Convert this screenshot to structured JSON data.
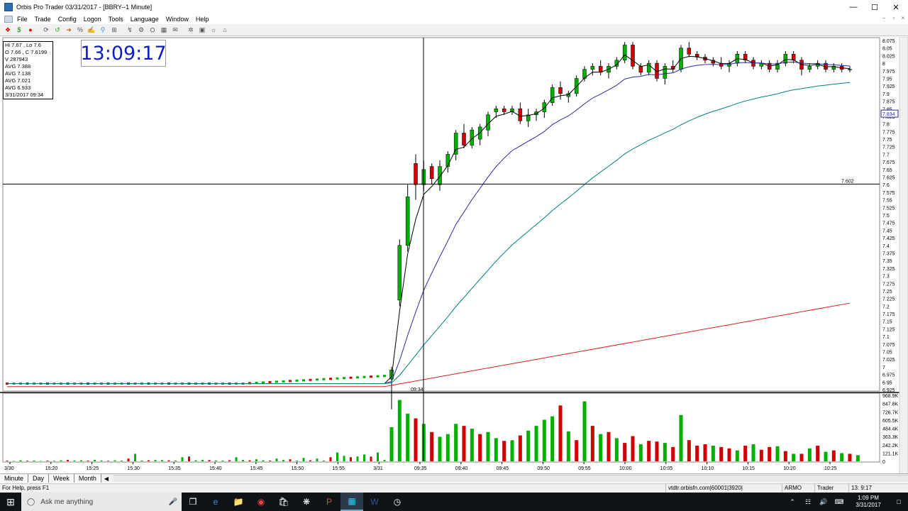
{
  "window": {
    "title": "Orbis Pro Trader 03/31/2017 - [BBRY--1 Minute]",
    "minimize": "—",
    "maximize": "☐",
    "close": "✕"
  },
  "menu": [
    "File",
    "Trade",
    "Config",
    "Logon",
    "Tools",
    "Language",
    "Window",
    "Help"
  ],
  "mdi_controls": [
    "–",
    "▫",
    "×"
  ],
  "info": [
    "Hi 7.67 , Lo 7.6",
    "O 7.66 , C 7.6199",
    "V 287943",
    "AVG 7.388",
    "AVG 7.138",
    "AVG 7.021",
    "AVG 6.933",
    "3/31/2017 09:34"
  ],
  "clock": "13:09:17",
  "chart_data": {
    "type": "candlestick",
    "symbol": "BBRY",
    "interval": "1 Minute",
    "price_axis": [
      "8.075",
      "8.05",
      "8.025",
      "8",
      "7.975",
      "7.95",
      "7.925",
      "7.9",
      "7.875",
      "7.85",
      "7.825",
      "7.8",
      "7.775",
      "7.75",
      "7.725",
      "7.7",
      "7.675",
      "7.65",
      "7.625",
      "7.6",
      "7.575",
      "7.55",
      "7.525",
      "7.5",
      "7.475",
      "7.45",
      "7.425",
      "7.4",
      "7.375",
      "7.35",
      "7.325",
      "7.3",
      "7.275",
      "7.25",
      "7.225",
      "7.2",
      "7.175",
      "7.15",
      "7.125",
      "7.1",
      "7.075",
      "7.05",
      "7.025",
      "7",
      "6.975",
      "6.95",
      "6.925"
    ],
    "ylim": [
      6.925,
      8.075
    ],
    "current_price_label": "7.834",
    "crosshair_price_label": "7.602",
    "crosshair_price": 7.602,
    "crosshair_time_label": "09:34",
    "volume_axis": [
      "968.9K",
      "847.8K",
      "726.7K",
      "605.5K",
      "484.4K",
      "363.3K",
      "242.2K",
      "121.1K",
      "0"
    ],
    "volume_max": 968.9,
    "time_axis": [
      "3/30",
      "15:20",
      "15:25",
      "15:30",
      "15:35",
      "15:40",
      "15:45",
      "15:50",
      "15:55",
      "3/31",
      "09:35",
      "09:40",
      "09:45",
      "09:50",
      "09:55",
      "10:00",
      "10:05",
      "10:10",
      "10:15",
      "10:20",
      "10:25"
    ],
    "preopen_close": 6.945,
    "candles": [
      {
        "o": 6.96,
        "h": 7.0,
        "l": 6.86,
        "c": 6.99
      },
      {
        "o": 7.22,
        "h": 7.42,
        "l": 7.2,
        "c": 7.4
      },
      {
        "o": 7.4,
        "h": 7.6,
        "l": 7.38,
        "c": 7.56
      },
      {
        "o": 7.67,
        "h": 7.7,
        "l": 7.55,
        "c": 7.6
      },
      {
        "o": 7.6,
        "h": 7.68,
        "l": 7.58,
        "c": 7.65
      },
      {
        "o": 7.66,
        "h": 7.67,
        "l": 7.6,
        "c": 7.62
      },
      {
        "o": 7.6,
        "h": 7.68,
        "l": 7.58,
        "c": 7.66
      },
      {
        "o": 7.66,
        "h": 7.71,
        "l": 7.64,
        "c": 7.7
      },
      {
        "o": 7.7,
        "h": 7.78,
        "l": 7.68,
        "c": 7.77
      },
      {
        "o": 7.77,
        "h": 7.8,
        "l": 7.72,
        "c": 7.73
      },
      {
        "o": 7.73,
        "h": 7.79,
        "l": 7.72,
        "c": 7.78
      },
      {
        "o": 7.75,
        "h": 7.8,
        "l": 7.73,
        "c": 7.79
      },
      {
        "o": 7.78,
        "h": 7.84,
        "l": 7.76,
        "c": 7.83
      },
      {
        "o": 7.84,
        "h": 7.86,
        "l": 7.82,
        "c": 7.85
      },
      {
        "o": 7.85,
        "h": 7.86,
        "l": 7.83,
        "c": 7.84
      },
      {
        "o": 7.84,
        "h": 7.86,
        "l": 7.83,
        "c": 7.85
      },
      {
        "o": 7.85,
        "h": 7.87,
        "l": 7.8,
        "c": 7.81
      },
      {
        "o": 7.81,
        "h": 7.85,
        "l": 7.79,
        "c": 7.83
      },
      {
        "o": 7.83,
        "h": 7.85,
        "l": 7.81,
        "c": 7.84
      },
      {
        "o": 7.84,
        "h": 7.88,
        "l": 7.82,
        "c": 7.87
      },
      {
        "o": 7.87,
        "h": 7.93,
        "l": 7.86,
        "c": 7.92
      },
      {
        "o": 7.92,
        "h": 7.94,
        "l": 7.88,
        "c": 7.9
      },
      {
        "o": 7.89,
        "h": 7.91,
        "l": 7.87,
        "c": 7.9
      },
      {
        "o": 7.9,
        "h": 7.96,
        "l": 7.89,
        "c": 7.95
      },
      {
        "o": 7.95,
        "h": 7.99,
        "l": 7.94,
        "c": 7.98
      },
      {
        "o": 7.98,
        "h": 8.0,
        "l": 7.96,
        "c": 7.99
      },
      {
        "o": 7.99,
        "h": 8.01,
        "l": 7.96,
        "c": 7.97
      },
      {
        "o": 7.97,
        "h": 8.0,
        "l": 7.95,
        "c": 7.99
      },
      {
        "o": 7.99,
        "h": 8.02,
        "l": 7.98,
        "c": 8.01
      },
      {
        "o": 8.01,
        "h": 8.07,
        "l": 8.0,
        "c": 8.06
      },
      {
        "o": 8.06,
        "h": 8.07,
        "l": 7.98,
        "c": 7.99
      },
      {
        "o": 7.99,
        "h": 8.0,
        "l": 7.96,
        "c": 7.97
      },
      {
        "o": 7.97,
        "h": 8.01,
        "l": 7.96,
        "c": 8.0
      },
      {
        "o": 8.0,
        "h": 8.01,
        "l": 7.94,
        "c": 7.95
      },
      {
        "o": 7.95,
        "h": 8.0,
        "l": 7.93,
        "c": 7.99
      },
      {
        "o": 7.99,
        "h": 8.01,
        "l": 7.97,
        "c": 7.98
      },
      {
        "o": 7.98,
        "h": 8.06,
        "l": 7.97,
        "c": 8.05
      },
      {
        "o": 8.05,
        "h": 8.07,
        "l": 8.02,
        "c": 8.03
      },
      {
        "o": 8.03,
        "h": 8.04,
        "l": 8.01,
        "c": 8.02
      },
      {
        "o": 8.02,
        "h": 8.03,
        "l": 8.0,
        "c": 8.01
      },
      {
        "o": 8.01,
        "h": 8.02,
        "l": 7.99,
        "c": 8.0
      },
      {
        "o": 8.0,
        "h": 8.02,
        "l": 7.98,
        "c": 7.99
      },
      {
        "o": 7.99,
        "h": 8.01,
        "l": 7.97,
        "c": 8.0
      },
      {
        "o": 8.0,
        "h": 8.04,
        "l": 7.99,
        "c": 8.03
      },
      {
        "o": 8.03,
        "h": 8.04,
        "l": 8.0,
        "c": 8.01
      },
      {
        "o": 8.01,
        "h": 8.02,
        "l": 7.98,
        "c": 7.99
      },
      {
        "o": 7.99,
        "h": 8.01,
        "l": 7.98,
        "c": 8.0
      },
      {
        "o": 8.0,
        "h": 8.01,
        "l": 7.97,
        "c": 7.98
      },
      {
        "o": 7.98,
        "h": 8.01,
        "l": 7.97,
        "c": 8.0
      },
      {
        "o": 8.0,
        "h": 8.04,
        "l": 7.99,
        "c": 8.03
      },
      {
        "o": 8.03,
        "h": 8.04,
        "l": 8.0,
        "c": 8.01
      },
      {
        "o": 8.01,
        "h": 8.02,
        "l": 7.96,
        "c": 7.98
      },
      {
        "o": 7.98,
        "h": 8.0,
        "l": 7.97,
        "c": 7.99
      },
      {
        "o": 7.99,
        "h": 8.01,
        "l": 7.98,
        "c": 8.0
      },
      {
        "o": 8.0,
        "h": 8.01,
        "l": 7.97,
        "c": 7.98
      },
      {
        "o": 7.98,
        "h": 8.0,
        "l": 7.97,
        "c": 7.99
      },
      {
        "o": 7.99,
        "h": 8.0,
        "l": 7.97,
        "c": 7.98
      },
      {
        "o": 7.98,
        "h": 7.99,
        "l": 7.97,
        "c": 7.98
      }
    ],
    "volumes": [
      500,
      900,
      700,
      630,
      550,
      430,
      360,
      400,
      550,
      520,
      480,
      400,
      430,
      340,
      300,
      310,
      380,
      450,
      520,
      610,
      660,
      820,
      440,
      310,
      880,
      520,
      400,
      430,
      340,
      270,
      370,
      250,
      300,
      290,
      270,
      210,
      680,
      310,
      230,
      250,
      230,
      210,
      190,
      160,
      230,
      250,
      170,
      210,
      220,
      150,
      110,
      110,
      190,
      230,
      140,
      160,
      120,
      110,
      90
    ],
    "volume_colors": [
      "g",
      "g",
      "g",
      "r",
      "g",
      "r",
      "g",
      "g",
      "g",
      "r",
      "g",
      "r",
      "g",
      "g",
      "r",
      "g",
      "r",
      "g",
      "g",
      "g",
      "g",
      "r",
      "g",
      "r",
      "g",
      "r",
      "g",
      "r",
      "g",
      "r",
      "r",
      "g",
      "r",
      "r",
      "g",
      "r",
      "g",
      "r",
      "r",
      "r",
      "g",
      "r",
      "r",
      "g",
      "r",
      "g",
      "r",
      "r",
      "g",
      "r",
      "g",
      "r",
      "g",
      "r",
      "g",
      "r",
      "g",
      "r",
      "g"
    ],
    "preopen_volumes": [
      10,
      5,
      15,
      8,
      12,
      5,
      10,
      8,
      15,
      20,
      12,
      15,
      10,
      20,
      12,
      8,
      15,
      10,
      40,
      110,
      12,
      15,
      20,
      18,
      15,
      10,
      60,
      70,
      15,
      20,
      18,
      12,
      10,
      15,
      60,
      20,
      15,
      30,
      15,
      10,
      40,
      20,
      30,
      10,
      50,
      15,
      40,
      10,
      60,
      130,
      80,
      60,
      70,
      100,
      70,
      130,
      20
    ],
    "colors": {
      "up": "#00b000",
      "down": "#d00000",
      "ema_fast": "#000000",
      "ema_mid": "#2a2aa0",
      "ema_slow": "#008080",
      "ema_long": "#d02020"
    }
  },
  "period_tabs": [
    "Minute",
    "Day",
    "Week",
    "Month"
  ],
  "status": {
    "help": "For Help, press F1",
    "server": "vtdtr.orbisfn.com|60001|3920|",
    "account": "ARMO",
    "role": "Trader",
    "time": "13: 9:17"
  },
  "taskbar": {
    "search_placeholder": "Ask me anything",
    "time": "1:09 PM",
    "date": "3/31/2017"
  }
}
